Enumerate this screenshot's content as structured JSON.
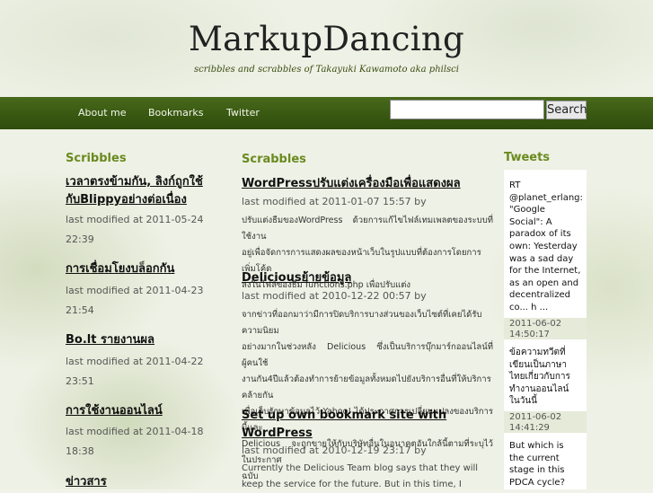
{
  "site": {
    "title": "MarkupDancing",
    "tagline": "scribbles and scrabbles of Takayuki Kawamoto aka philsci"
  },
  "nav": {
    "items": [
      "About me",
      "Bookmarks",
      "Twitter"
    ],
    "search_value": "",
    "search_button": "Search"
  },
  "scribbles": {
    "heading": "Scribbles",
    "posts": [
      {
        "title_line1": "เวลาตรงข้ามกัน, ลิงก์ถูกใช้",
        "title_line2": "กับBlippyอย่างต่อเนื่อง",
        "modified_line1": "last modified at 2011-05-24",
        "modified_line2": "22:39"
      },
      {
        "title_line1": "การเชื่อมโยงบล็อกกัน",
        "modified_line1": "last modified at 2011-04-23",
        "modified_line2": "21:54"
      },
      {
        "title_line1": "Bo.lt รายงานผล",
        "modified_line1": "last modified at 2011-04-22",
        "modified_line2": "23:51"
      },
      {
        "title_line1": "การใช้งานออนไลน์",
        "modified_line1": "last modified at 2011-04-18",
        "modified_line2": "18:38"
      },
      {
        "title_line1": "ข่าวสาร"
      }
    ]
  },
  "scrabbles": {
    "heading": "Scrabbles",
    "posts": [
      {
        "title": "WordPressปรับแต่งเครื่องมือเพื่อแสดงผล",
        "modified": "last modified at 2011-01-07 15:57 by",
        "excerpt": [
          "ปรับแต่งธีมของWordPress  ด้วยการแก้ไขไฟล์เทมเพลตของระบบที่ใช้งาน",
          "อยู่เพื่อจัดการการแสดงผลของหน้าเว็บในรูปแบบที่ต้องการโดยการเพิ่มโค้ด",
          "ลงในไฟล์ของธีม functions.php เพื่อปรับแต่ง"
        ]
      },
      {
        "title": "Deliciousย้ายข้อมูล",
        "modified": "last modified at 2010-12-22 00:57 by",
        "excerpt": [
          "จากข่าวที่ออกมาว่ามีการปิดบริการบางส่วนของเว็บไซต์ที่เคยได้รับความนิยม",
          "อย่างมากในช่วงหลัง Delicious  ซึ่งเป็นบริการบุ๊กมาร์กออนไลน์ที่ผู้คนใช้",
          "งานกัน4ปีแล้วต้องทำการย้ายข้อมูลทั้งหมดไปยังบริการอื่นที่ให้บริการคล้ายกัน",
          "เพื่อเก็บรักษาข้อมูลไว้ Yahoo!  ได้ประกาศการเปลี่ยนแปลงของบริการนี้และ",
          "Delicious  จะถูกขายให้กับบริษัทอื่นในอนาคตอันใกล้นี้ตามที่ระบุไว้ในประกาศ",
          "ฉบับ"
        ]
      },
      {
        "title_line1": "Set up own bookmark site with",
        "title_line2": "WordPress",
        "modified": "last modified at 2010-12-19 23:17 by",
        "excerpt": [
          "Currently the Delicious Team blog says that they will",
          "keep the service for the future.  But in this time, I"
        ]
      }
    ]
  },
  "tweets": {
    "heading": "Tweets",
    "items": [
      {
        "text": [
          "RT",
          "@planet_erlang:",
          "\"Google",
          "Social\": A",
          "paradox of its",
          "own: Yesterday",
          "was a sad day",
          "for the Internet,",
          "as an open and",
          "decentralized",
          "co... h ..."
        ],
        "time": [
          "2011-06-02",
          "14:50:17"
        ]
      },
      {
        "text": [
          "ข้อความทวีตที่",
          "เขียนเป็นภาษา",
          "ไทยเกี่ยวกับการ",
          "ทำงานออนไลน์",
          "ในวันนี้"
        ],
        "time": [
          "2011-06-02",
          "14:41:29"
        ]
      },
      {
        "text": [
          "But which is",
          "the current",
          "stage in this",
          "PDCA cycle?"
        ]
      }
    ]
  }
}
